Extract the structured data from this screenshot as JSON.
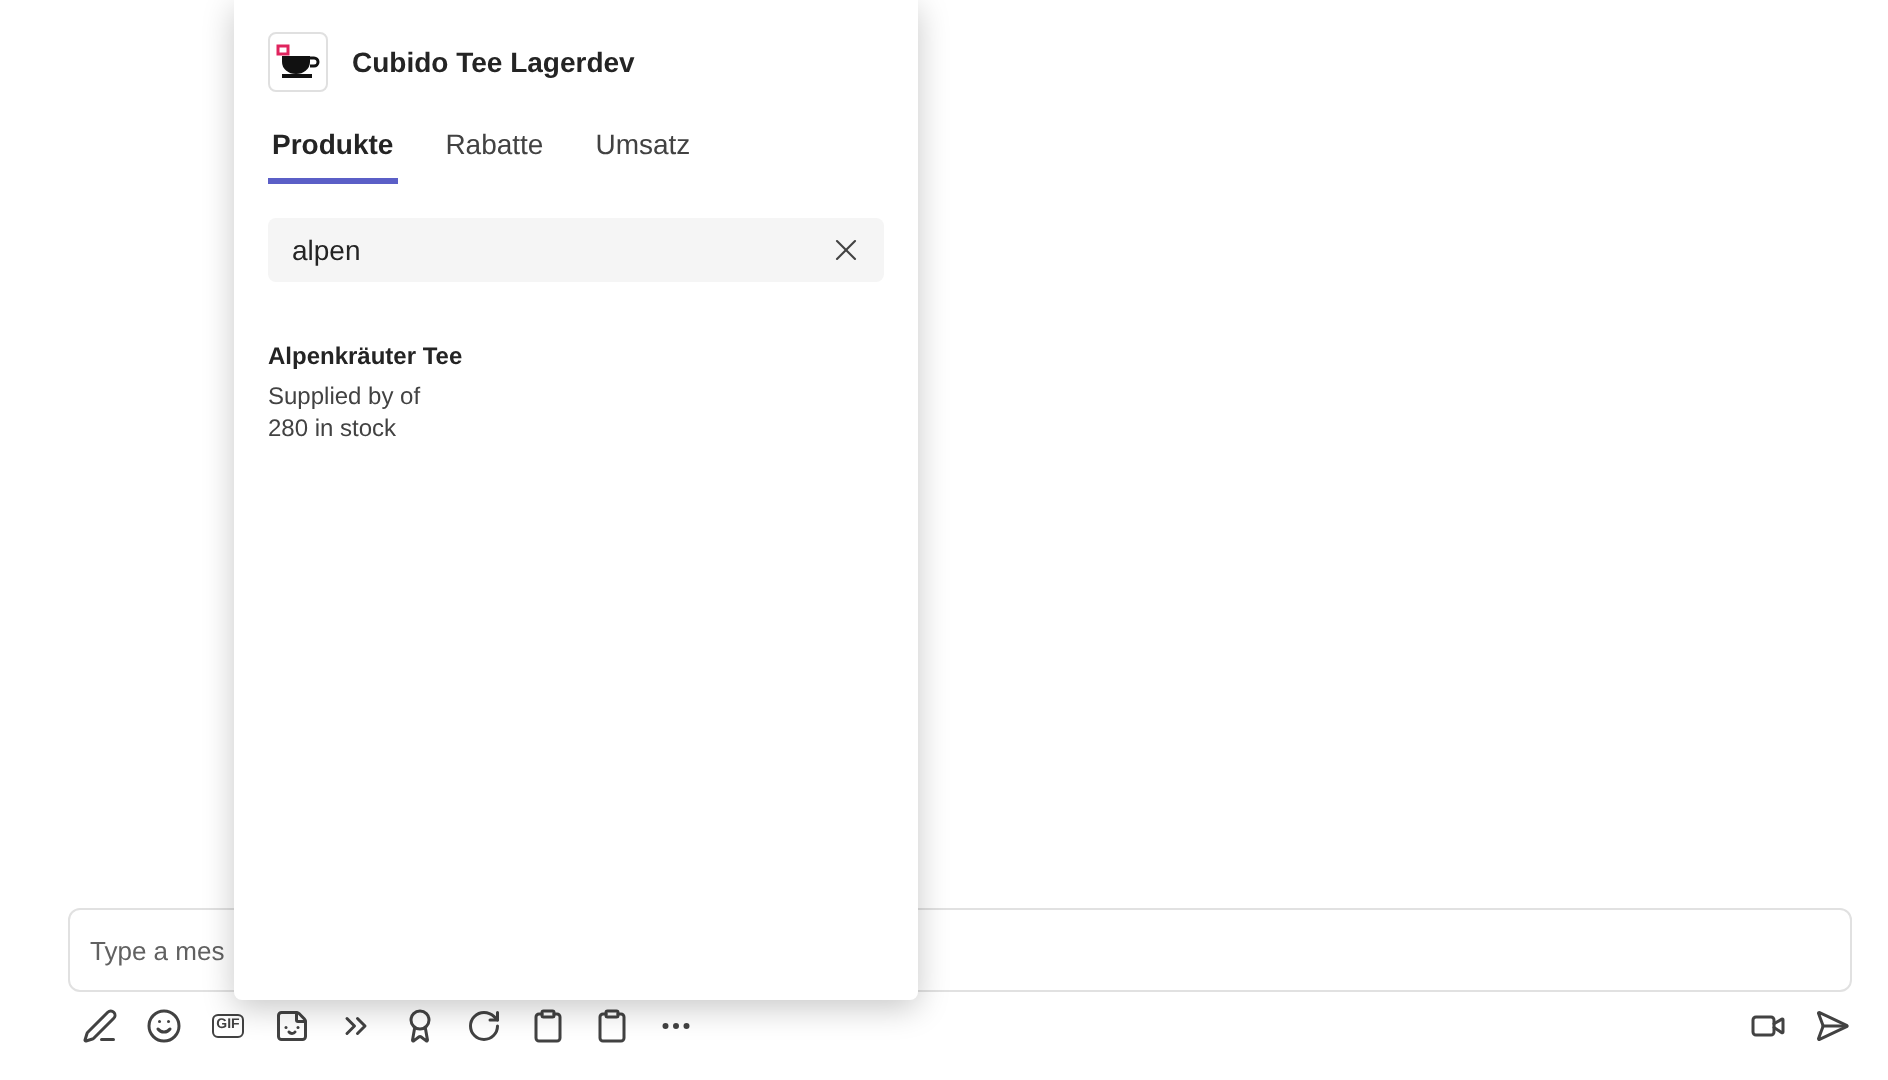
{
  "compose": {
    "placeholder": "Type a mes",
    "gif_label": "GIF"
  },
  "popup": {
    "app_title": "Cubido Tee Lagerdev",
    "tabs": [
      {
        "label": "Produkte",
        "selected": true
      },
      {
        "label": "Rabatte",
        "selected": false
      },
      {
        "label": "Umsatz",
        "selected": false
      }
    ],
    "search": {
      "value": "alpen"
    },
    "results": [
      {
        "name": "Alpenkräuter Tee",
        "supplier": "Supplied by of",
        "stock": "280 in stock"
      }
    ]
  }
}
